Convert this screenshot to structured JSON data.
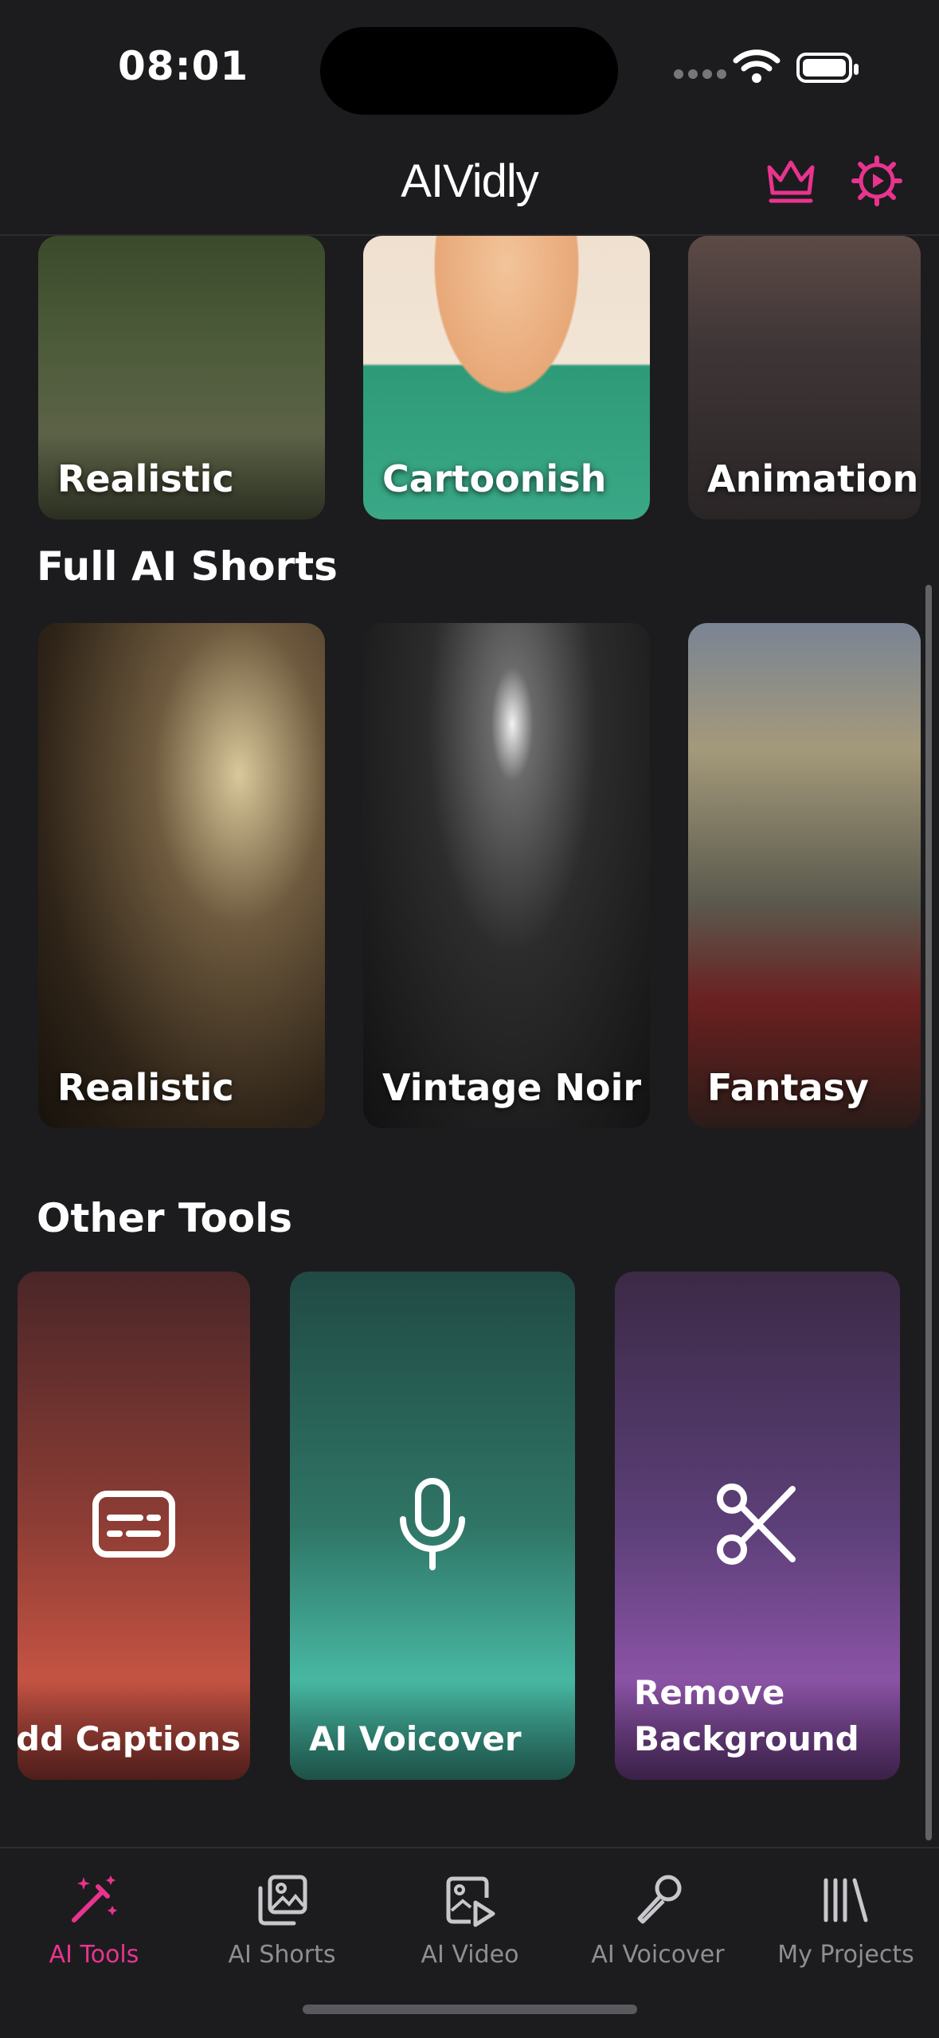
{
  "status_bar": {
    "time": "08:01"
  },
  "header": {
    "title": "AIVidly"
  },
  "top_row": [
    {
      "label": "Realistic"
    },
    {
      "label": "Cartoonish"
    },
    {
      "label": "Animation"
    }
  ],
  "full_ai_shorts": {
    "title": "Full AI Shorts",
    "items": [
      {
        "label": "Realistic"
      },
      {
        "label": "Vintage Noir"
      },
      {
        "label": "Fantasy"
      }
    ]
  },
  "other_tools": {
    "title": "Other Tools",
    "items": [
      {
        "label": "dd Captions",
        "icon": "captions-icon"
      },
      {
        "label": "AI Voicover",
        "icon": "microphone-icon"
      },
      {
        "label_line1": "Remove",
        "label_line2": "Background",
        "icon": "scissors-icon"
      }
    ]
  },
  "tabbar": {
    "items": [
      {
        "label": "AI Tools",
        "icon": "magic-wand-icon",
        "active": true
      },
      {
        "label": "AI Shorts",
        "icon": "image-stack-icon"
      },
      {
        "label": "AI Video",
        "icon": "video-image-icon"
      },
      {
        "label": "AI Voicover",
        "icon": "microphone-icon"
      },
      {
        "label": "My Projects",
        "icon": "library-icon"
      }
    ]
  },
  "colors": {
    "accent": "#e8348f",
    "background": "#1c1c1e"
  }
}
